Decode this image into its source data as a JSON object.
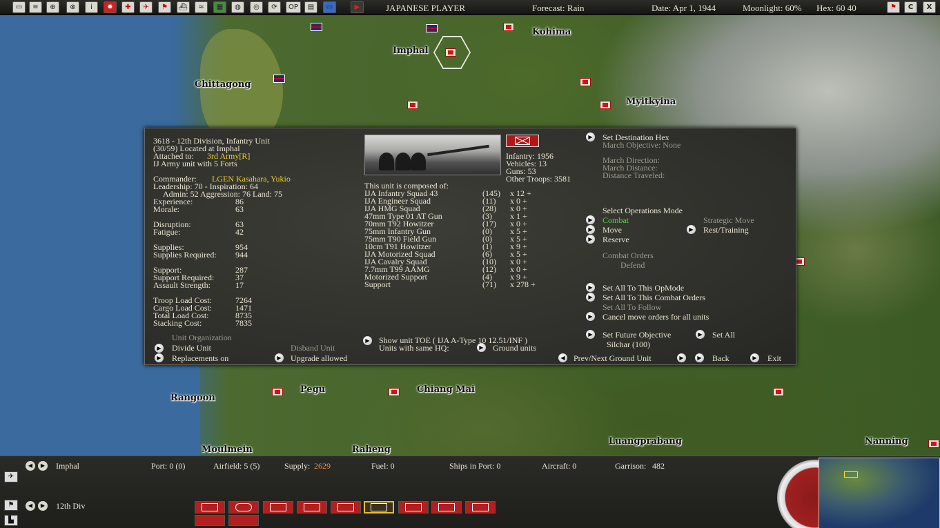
{
  "topbar": {
    "player": "JAPANESE PLAYER",
    "forecast": "Forecast: Rain",
    "date": "Date: Apr 1, 1944",
    "moonlight": "Moonlight: 60%",
    "hex": "Hex: 60 40",
    "buttons": [
      "log-icon",
      "list-icon",
      "group-icon",
      "unit-icon",
      "info-icon",
      "japan-flag-icon",
      "army-icon",
      "air-icon",
      "flag-icon",
      "ship-icon",
      "chart-icon",
      "map-icon",
      "globe-icon",
      "target-icon",
      "op-icon",
      "grid-icon",
      "photo-icon",
      "play-icon"
    ],
    "op_label": "OP",
    "right_buttons": [
      "flag-icon",
      "C",
      "X"
    ]
  },
  "map": {
    "cities": [
      "Kohima",
      "Imphal",
      "Chittagong",
      "Myitkyina",
      "Rangoon",
      "Pegu",
      "Chiang Mai",
      "Moulmein",
      "Raheng",
      "Luangprabang",
      "Nanning"
    ]
  },
  "unit": {
    "header": "3618 - 12th Division, Infantry Unit",
    "location": "(30/59) Located at Imphal",
    "attached_label": "Attached to:",
    "attached_value": "3rd Army[R]",
    "forts": "IJ Army unit with 5 Forts",
    "commander_label": "Commander:",
    "commander_value": "LGEN Kasahara, Yukio",
    "leadership": "Leadership: 70 - Inspiration: 64",
    "admin": "Admin: 52  Aggression: 76 Land: 75",
    "stats": [
      {
        "label": "Experience:",
        "value": "86"
      },
      {
        "label": "Morale:",
        "value": "63"
      },
      {
        "label": "Disruption:",
        "value": "63"
      },
      {
        "label": "Fatigue:",
        "value": "42"
      },
      {
        "label": "Supplies:",
        "value": "954"
      },
      {
        "label": "Supplies Required:",
        "value": "944"
      },
      {
        "label": "Support:",
        "value": "287"
      },
      {
        "label": "Support Required:",
        "value": "37"
      },
      {
        "label": "Assault Strength:",
        "value": "17"
      },
      {
        "label": "Troop Load Cost:",
        "value": "7264"
      },
      {
        "label": "Cargo Load Cost:",
        "value": "1471"
      },
      {
        "label": "Total Load Cost:",
        "value": "8735"
      },
      {
        "label": "Stacking Cost:",
        "value": "7835"
      }
    ],
    "org_title": "Unit Organization",
    "divide_unit": "Divide Unit",
    "disband_unit": "Disband Unit",
    "replacements": "Replacements on",
    "upgrade": "Upgrade allowed",
    "infantry": "Infantry: 1956",
    "vehicles": "Vehicles: 13",
    "guns": "Guns: 53",
    "other_troops": "Other Troops: 3581",
    "composed_title": "This unit is composed of:",
    "components": [
      {
        "name": "IJA Infantry Squad  43",
        "num": "(145)",
        "mult": "x 12 +"
      },
      {
        "name": "IJA Engineer Squad",
        "num": "(11)",
        "mult": "x 0 +"
      },
      {
        "name": "IJA HMG Squad",
        "num": "(28)",
        "mult": "x 0 +"
      },
      {
        "name": "47mm Type 01 AT Gun",
        "num": "(3)",
        "mult": "x 1 +"
      },
      {
        "name": "70mm T92 Howitzer",
        "num": "(17)",
        "mult": "x 0 +"
      },
      {
        "name": "75mm Infantry Gun",
        "num": "(0)",
        "mult": "x 5 +"
      },
      {
        "name": "75mm T90 Field Gun",
        "num": "(0)",
        "mult": "x 5 +"
      },
      {
        "name": "10cm T91 Howitzer",
        "num": "(1)",
        "mult": "x 9 +"
      },
      {
        "name": "IJA Motorized Squad",
        "num": "(6)",
        "mult": "x 5 +"
      },
      {
        "name": "IJA Cavalry Squad",
        "num": "(10)",
        "mult": "x 0 +"
      },
      {
        "name": "7.7mm T99 AAMG",
        "num": "(12)",
        "mult": "x 0 +"
      },
      {
        "name": "Motorized Support",
        "num": "(4)",
        "mult": "x 9 +"
      },
      {
        "name": "Support",
        "num": "(71)",
        "mult": "x 278 +"
      }
    ],
    "show_toe": "Show unit TOE ( IJA A-Type 10 12.51/INF )",
    "same_hq": "Units with same HQ:",
    "ground_units": "Ground units"
  },
  "orders": {
    "set_dest": "Set Destination Hex",
    "march_obj": "March Objective: None",
    "march_dir": "March Direction:",
    "march_dist": "March Distance:",
    "dist_traveled": "Distance Traveled:",
    "select_ops": "Select Operations Mode",
    "combat": "Combat",
    "strategic": "Strategic Move",
    "move": "Move",
    "rest": "Rest/Training",
    "reserve": "Reserve",
    "combat_orders": "Combat Orders",
    "defend": "Defend",
    "set_all_op": "Set All To This OpMode",
    "set_all_combat": "Set All To This Combat Orders",
    "set_all_follow": "Set All To Follow",
    "cancel_move": "Cancel move orders for all units",
    "future_obj": "Set Future Objective",
    "set_all": "Set All",
    "silchar": "Silchar (100)",
    "prev_next": "Prev/Next Ground Unit",
    "back": "Back",
    "exit": "Exit"
  },
  "bottom": {
    "location": "Imphal",
    "port": "Port: 0 (0)",
    "airfield": "Airfield: 5 (5)",
    "supply_label": "Supply:",
    "supply_value": "2629",
    "fuel": "Fuel: 0",
    "ships": "Ships in Port: 0",
    "aircraft": "Aircraft: 0",
    "garrison_label": "Garrison:",
    "garrison_value": "482",
    "unit_name": "12th Div"
  }
}
